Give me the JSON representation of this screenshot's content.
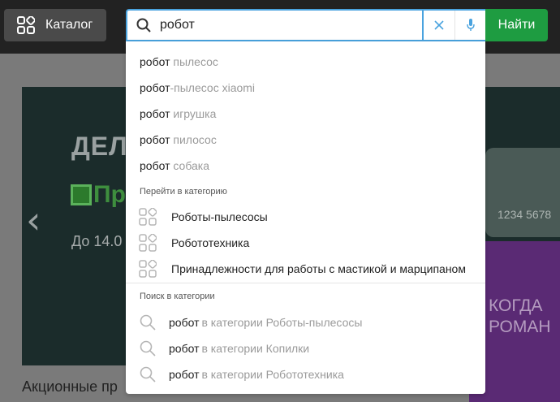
{
  "header": {
    "catalog_label": "Каталог",
    "search_value": "робот",
    "find_label": "Найти"
  },
  "background": {
    "banner_heading": "ДЕЛ",
    "banner_logo_text": "Пр",
    "banner_date": "До 14.0",
    "card_number": "1234  5678",
    "purple_line_1": "КОГДА",
    "purple_line_2": "РОМАН",
    "promo_heading": "Акционные пр"
  },
  "dropdown": {
    "suggestions": [
      {
        "query": "робот",
        "rest": " пылесос"
      },
      {
        "query": "робот",
        "rest": "-пылесос xiaomi"
      },
      {
        "query": "робот",
        "rest": " игрушка"
      },
      {
        "query": "робот",
        "rest": " пилосос"
      },
      {
        "query": "робот",
        "rest": " собака"
      }
    ],
    "categories_title": "Перейти в категорию",
    "categories": [
      "Роботы-пылесосы",
      "Робототехника",
      "Принадлежности для работы с мастикой и марципаном"
    ],
    "scope_title": "Поиск в категории",
    "scoped": [
      {
        "query": "робот",
        "rest": "в категории Роботы-пылесосы"
      },
      {
        "query": "робот",
        "rest": "в категории Копилки"
      },
      {
        "query": "робот",
        "rest": "в категории Робототехника"
      }
    ]
  },
  "colors": {
    "topbar": "#222222",
    "find_button": "#1e9c41",
    "focus_border": "#4aa3df",
    "suggestion_rest": "#9a9a9a"
  }
}
